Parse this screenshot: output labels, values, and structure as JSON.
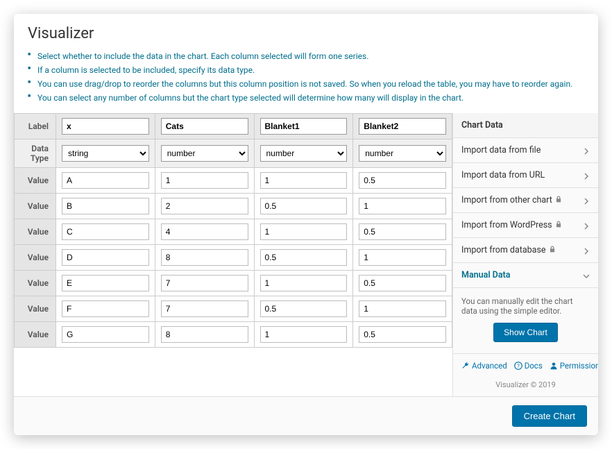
{
  "title": "Visualizer",
  "bullets": [
    "Select whether to include the data in the chart. Each column selected will form one series.",
    "If a column is selected to be included, specify its data type.",
    "You can use drag/drop to reorder the columns but this column position is not saved. So when you reload the table, you may have to reorder again.",
    "You can select any number of columns but the chart type selected will determine how many will display in the chart."
  ],
  "grid": {
    "rowhdr_label": "Label",
    "rowhdr_type": "Data Type",
    "rowhdr_value": "Value",
    "labels": [
      "x",
      "Cats",
      "Blanket1",
      "Blanket2"
    ],
    "types": [
      "string",
      "number",
      "number",
      "number"
    ],
    "rows": [
      [
        "A",
        "1",
        "1",
        "0.5"
      ],
      [
        "B",
        "2",
        "0.5",
        "1"
      ],
      [
        "C",
        "4",
        "1",
        "0.5"
      ],
      [
        "D",
        "8",
        "0.5",
        "1"
      ],
      [
        "E",
        "7",
        "1",
        "0.5"
      ],
      [
        "F",
        "7",
        "0.5",
        "1"
      ],
      [
        "G",
        "8",
        "1",
        "0.5"
      ]
    ]
  },
  "sidebar": {
    "section_title": "Chart Data",
    "items": [
      {
        "label": "Import data from file",
        "locked": false
      },
      {
        "label": "Import data from URL",
        "locked": false
      },
      {
        "label": "Import from other chart",
        "locked": true
      },
      {
        "label": "Import from WordPress",
        "locked": true
      },
      {
        "label": "Import from database",
        "locked": true
      }
    ],
    "active": {
      "label": "Manual Data"
    },
    "panel_text": "You can manually edit the chart data using the simple editor.",
    "show_chart": "Show Chart",
    "links": {
      "advanced": "Advanced",
      "docs": "Docs",
      "permissions": "Permissions"
    },
    "copyright": "Visualizer © 2019"
  },
  "create_button": "Create Chart",
  "chart_data": {
    "type": "table",
    "columns": [
      "x",
      "Cats",
      "Blanket1",
      "Blanket2"
    ],
    "column_types": [
      "string",
      "number",
      "number",
      "number"
    ],
    "rows": [
      [
        "A",
        1,
        1,
        0.5
      ],
      [
        "B",
        2,
        0.5,
        1
      ],
      [
        "C",
        4,
        1,
        0.5
      ],
      [
        "D",
        8,
        0.5,
        1
      ],
      [
        "E",
        7,
        1,
        0.5
      ],
      [
        "F",
        7,
        0.5,
        1
      ],
      [
        "G",
        8,
        1,
        0.5
      ]
    ]
  }
}
